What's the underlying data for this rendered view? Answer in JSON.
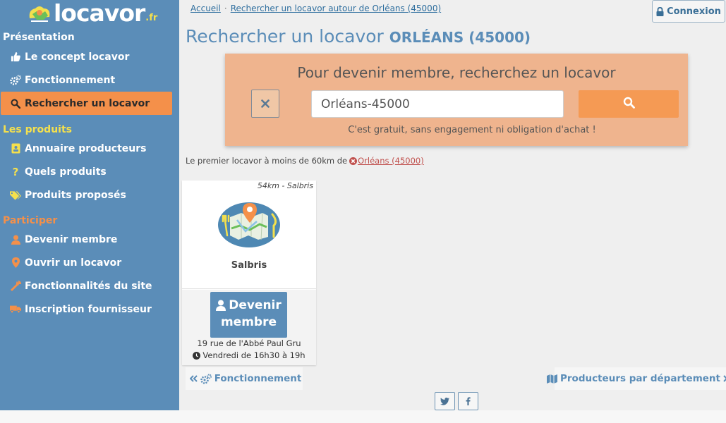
{
  "logo": {
    "word": "locavor",
    "tld": ".fr"
  },
  "sidebar": {
    "sections": [
      {
        "title": "Présentation",
        "color": "#ffffff"
      },
      {
        "title": "Les produits",
        "color": "#f4e04d"
      },
      {
        "title": "Participer",
        "color": "#f4904a"
      }
    ],
    "items": [
      {
        "label": "Le concept locavor",
        "icon": "thumbs-up-icon"
      },
      {
        "label": "Fonctionnement",
        "icon": "cogs-icon"
      },
      {
        "label": "Rechercher un locavor",
        "icon": "search-icon",
        "active": true
      },
      {
        "label": "Annuaire producteurs",
        "icon": "address-book-icon"
      },
      {
        "label": "Quels produits",
        "icon": "question-icon"
      },
      {
        "label": "Produits proposés",
        "icon": "tags-icon"
      },
      {
        "label": "Devenir membre",
        "icon": "user-icon"
      },
      {
        "label": "Ouvrir un locavor",
        "icon": "map-marker-icon"
      },
      {
        "label": "Fonctionnalités du site",
        "icon": "wrench-icon"
      },
      {
        "label": "Inscription fournisseur",
        "icon": "truck-icon"
      }
    ]
  },
  "breadcrumb": {
    "home": "Accueil",
    "sep": "·",
    "current": "Rechercher un locavor autour de Orléans (45000)"
  },
  "header": {
    "login_label": "Connexion"
  },
  "page": {
    "title": "Rechercher un locavor",
    "city": "ORLÉANS (45000)"
  },
  "search": {
    "heading": "Pour devenir membre, recherchez un locavor",
    "value": "Orléans-45000",
    "note": "C'est gratuit, sans engagement ni obligation d'achat !"
  },
  "result": {
    "text": "Le premier locavor à moins de 60km de",
    "location": "Orléans (45000)"
  },
  "card": {
    "distance": "54km - Salbris",
    "name": "Salbris",
    "join_line1": "Devenir",
    "join_line2": "membre",
    "address": "19 rue de l'Abbé Paul Gru",
    "hours": "Vendredi de 16h30 à 19h"
  },
  "pager": {
    "prev": "Fonctionnement",
    "next": "Producteurs par département"
  },
  "colors": {
    "sidebar": "#5b8db8",
    "accent": "#f4904a",
    "search_bg": "#efb48e",
    "title": "#5b8db8"
  }
}
